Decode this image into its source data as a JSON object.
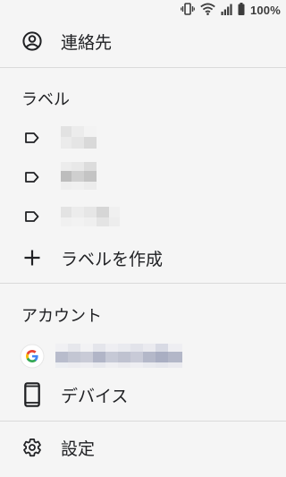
{
  "status_bar": {
    "battery": "100%",
    "icons": [
      "vibrate-icon",
      "wifi-icon",
      "signal-icon",
      "battery-icon"
    ]
  },
  "contacts": {
    "label": "連絡先",
    "icon": "account-circle-icon"
  },
  "labels_section": {
    "title": "ラベル",
    "items": [
      {
        "icon": "label-icon"
      },
      {
        "icon": "label-icon"
      },
      {
        "icon": "label-icon"
      }
    ],
    "create_label": "ラベルを作成",
    "create_icon": "plus-icon"
  },
  "account_section": {
    "title": "アカウント",
    "account_icon": "google-icon"
  },
  "devices": {
    "label": "デバイス",
    "icon": "phone-icon"
  },
  "settings": {
    "label": "設定",
    "icon": "gear-icon"
  },
  "colors": {
    "background": "#f5f5f5",
    "text": "#202124",
    "divider": "#dadada",
    "google_blue": "#4285F4",
    "google_red": "#EA4335",
    "google_yellow": "#FBBC05",
    "google_green": "#34A853"
  }
}
